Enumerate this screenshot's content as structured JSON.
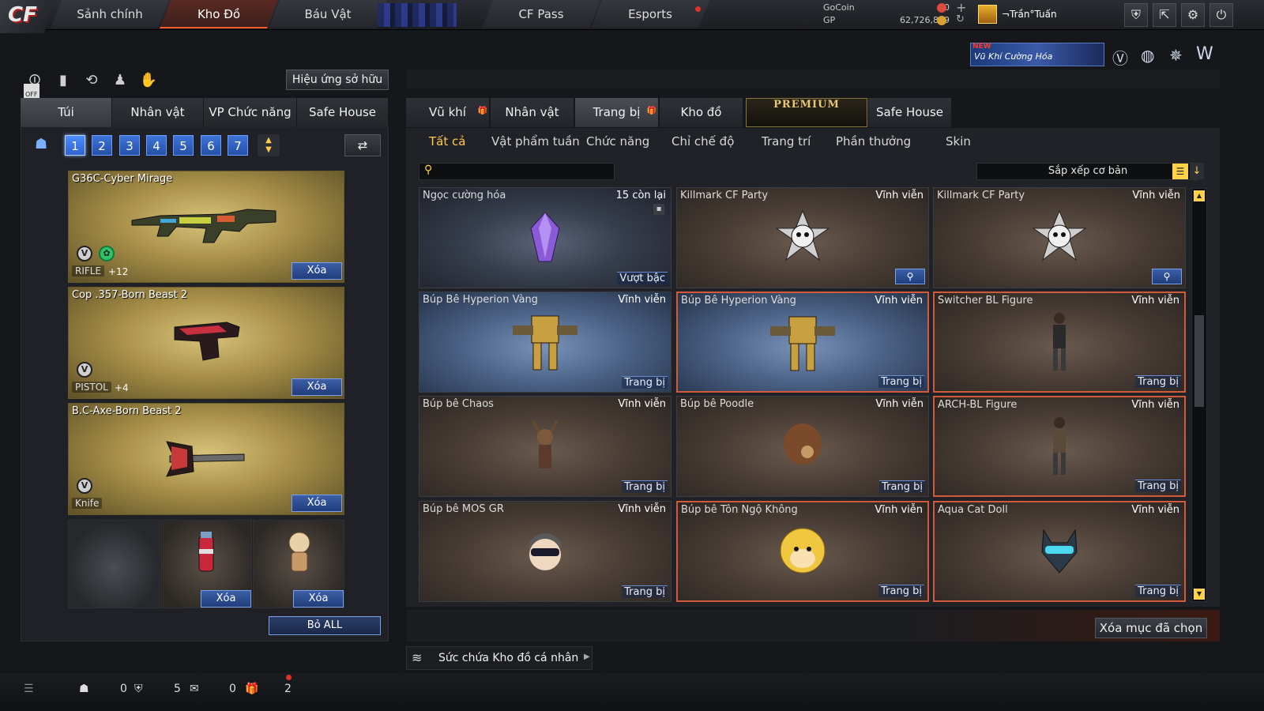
{
  "topnav": {
    "logo": "CF",
    "tabs": [
      {
        "label": "Sảnh chính"
      },
      {
        "label": "Kho Đồ"
      },
      {
        "label": "Báu Vật"
      },
      {
        "label": "CF Pass"
      },
      {
        "label": "Esports"
      }
    ],
    "currency": {
      "gocoin_label": "GoCoin",
      "gocoin_value": "0",
      "gp_label": "GP",
      "gp_value": "62,726,849"
    },
    "username": "¬Trần°Tuấn",
    "icons": [
      "shield-icon",
      "exit-icon",
      "gear-icon",
      "power-icon"
    ]
  },
  "promo": {
    "badge": "NEW",
    "text": "Vũ Khí Cường Hóa"
  },
  "left": {
    "effect_button": "Hiệu ứng sở hữu",
    "off_label": "OFF",
    "tabs": [
      {
        "label": "Túi"
      },
      {
        "label": "Nhân vật"
      },
      {
        "label": "VP Chức năng"
      },
      {
        "label": "Safe House"
      }
    ],
    "bags": [
      "1",
      "2",
      "3",
      "4",
      "5",
      "6",
      "7"
    ],
    "weapons": [
      {
        "name": "G36C-Cyber Mirage",
        "class": "RIFLE",
        "level": "+12",
        "remove": "Xóa"
      },
      {
        "name": "Cop .357-Born Beast 2",
        "class": "PISTOL",
        "level": "+4",
        "remove": "Xóa"
      },
      {
        "name": "B.C-Axe-Born Beast 2",
        "class": "Knife",
        "level": "",
        "remove": "Xóa"
      }
    ],
    "slots": [
      {
        "remove": "Xóa"
      },
      {
        "remove": "Xóa"
      }
    ],
    "remove_all": "Bỏ ALL"
  },
  "right": {
    "tabs": [
      {
        "label": "Vũ khí"
      },
      {
        "label": "Nhân vật"
      },
      {
        "label": "Trang bị"
      },
      {
        "label": "Kho đồ"
      },
      {
        "label": "PREMIUM"
      },
      {
        "label": "Safe House"
      }
    ],
    "subtabs": [
      {
        "label": "Tất cả"
      },
      {
        "label": "Vật phẩm tuần"
      },
      {
        "label": "Chức năng"
      },
      {
        "label": "Chỉ chế độ"
      },
      {
        "label": "Trang trí"
      },
      {
        "label": "Phần thưởng"
      },
      {
        "label": "Skin"
      }
    ],
    "search_placeholder": "",
    "sort_label": "Sắp xếp cơ bản",
    "items": [
      {
        "title": "Ngọc cường hóa",
        "duration": "15 còn lại",
        "action": "Vượt bậc",
        "icon": "gem-icon"
      },
      {
        "title": "Killmark CF Party",
        "duration": "Vĩnh viễn",
        "action": "",
        "icon": "skull-icon"
      },
      {
        "title": "Killmark CF Party",
        "duration": "Vĩnh viễn",
        "action": "",
        "icon": "skull-icon"
      },
      {
        "title": "Búp Bê Hyperion Vàng",
        "duration": "Vĩnh viễn",
        "action": "Trang bị",
        "icon": "mech-icon"
      },
      {
        "title": "Búp Bê Hyperion Vàng",
        "duration": "Vĩnh viễn",
        "action": "Trang bị",
        "icon": "mech-icon"
      },
      {
        "title": "Switcher BL Figure",
        "duration": "Vĩnh viễn",
        "action": "Trang bị",
        "icon": "figure-icon"
      },
      {
        "title": "Búp bê Chaos",
        "duration": "Vĩnh viễn",
        "action": "Trang bị",
        "icon": "deer-icon"
      },
      {
        "title": "Búp bê Poodle",
        "duration": "Vĩnh viễn",
        "action": "Trang bị",
        "icon": "poodle-icon"
      },
      {
        "title": "ARCH-BL Figure",
        "duration": "Vĩnh viễn",
        "action": "Trang bị",
        "icon": "figure-icon"
      },
      {
        "title": "Búp bê MOS GR",
        "duration": "Vĩnh viễn",
        "action": "Trang bị",
        "icon": "face-icon"
      },
      {
        "title": "Búp bê Tôn Ngộ Không",
        "duration": "Vĩnh viễn",
        "action": "Trang bị",
        "icon": "monkey-icon"
      },
      {
        "title": "Aqua Cat Doll",
        "duration": "Vĩnh viễn",
        "action": "Trang bị",
        "icon": "cat-icon"
      }
    ],
    "delete_selected": "Xóa mục đã chọn",
    "capacity_label": "Sức chứa Kho đồ cá nhân"
  },
  "bottombar": {
    "values": [
      "0",
      "5",
      "0",
      "2"
    ]
  }
}
